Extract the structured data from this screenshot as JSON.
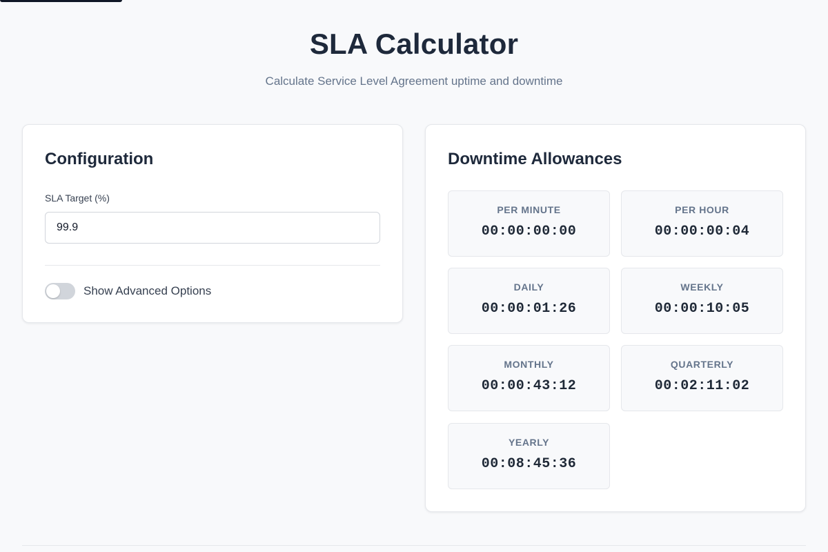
{
  "header": {
    "title": "SLA Calculator",
    "subtitle": "Calculate Service Level Agreement uptime and downtime"
  },
  "config": {
    "title": "Configuration",
    "sla_label": "SLA Target (%)",
    "sla_value": "99.9",
    "advanced_toggle_label": "Show Advanced Options",
    "advanced_toggle_on": false
  },
  "downtime": {
    "title": "Downtime Allowances",
    "items": [
      {
        "label": "PER MINUTE",
        "value": "00:00:00:00"
      },
      {
        "label": "PER HOUR",
        "value": "00:00:00:04"
      },
      {
        "label": "DAILY",
        "value": "00:00:01:26"
      },
      {
        "label": "WEEKLY",
        "value": "00:00:10:05"
      },
      {
        "label": "MONTHLY",
        "value": "00:00:43:12"
      },
      {
        "label": "QUARTERLY",
        "value": "00:02:11:02"
      },
      {
        "label": "YEARLY",
        "value": "00:08:45:36"
      }
    ]
  }
}
